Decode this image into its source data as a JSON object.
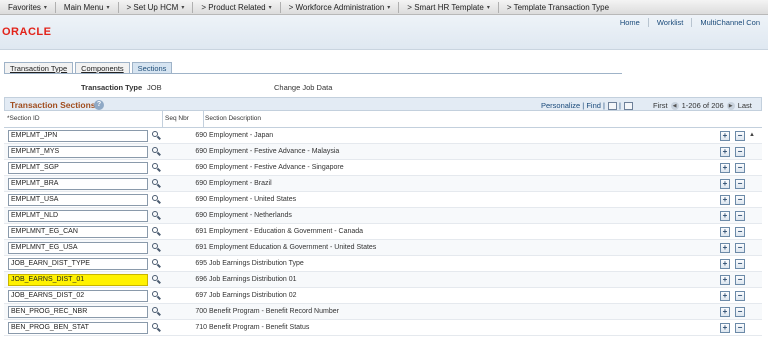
{
  "menubar": {
    "items": [
      {
        "label": "Favorites",
        "caret": "▾"
      },
      {
        "label": "Main Menu",
        "caret": "▾"
      },
      {
        "label": "> Set Up HCM",
        "caret": "▾"
      },
      {
        "label": "> Product Related",
        "caret": "▾"
      },
      {
        "label": "> Workforce Administration",
        "caret": "▾"
      },
      {
        "label": "> Smart HR Template",
        "caret": "▾"
      },
      {
        "label": "> Template Transaction Type",
        "caret": ""
      }
    ]
  },
  "header": {
    "logo": "ORACLE",
    "links": [
      "Home",
      "Worklist",
      "MultiChannel Con"
    ]
  },
  "tabs": [
    "Transaction Type",
    "Components",
    "Sections"
  ],
  "transaction_type": {
    "label": "Transaction Type",
    "value": "JOB",
    "description": "Change Job Data"
  },
  "grid": {
    "title": "Transaction Sections",
    "help": "?",
    "personalize": "Personalize",
    "find": "Find",
    "first": "First",
    "range": "1-206 of 206",
    "last": "Last",
    "columns": {
      "section_id": "*Section ID",
      "seq_nbr": "Seq Nbr",
      "section_desc": "Section Description"
    },
    "rows": [
      {
        "id": "EMPLMT_JPN",
        "seq": "690",
        "desc": "Employment - Japan"
      },
      {
        "id": "EMPLMT_MYS",
        "seq": "690",
        "desc": "Employment - Festive Advance - Malaysia"
      },
      {
        "id": "EMPLMT_SGP",
        "seq": "690",
        "desc": "Employment - Festive Advance - Singapore"
      },
      {
        "id": "EMPLMT_BRA",
        "seq": "690",
        "desc": "Employment - Brazil"
      },
      {
        "id": "EMPLMT_USA",
        "seq": "690",
        "desc": "Employment - United States"
      },
      {
        "id": "EMPLMT_NLD",
        "seq": "690",
        "desc": "Employment - Netherlands"
      },
      {
        "id": "EMPLMNT_EG_CAN",
        "seq": "691",
        "desc": "Employment - Education & Government - Canada"
      },
      {
        "id": "EMPLMNT_EG_USA",
        "seq": "691",
        "desc": "Employment Education & Government - United States"
      },
      {
        "id": "JOB_EARN_DIST_TYPE",
        "seq": "695",
        "desc": "Job Earnings Distribution Type"
      },
      {
        "id": "JOB_EARNS_DIST_01",
        "seq": "696",
        "desc": "Job Earnings Distribution 01",
        "highlighted": true
      },
      {
        "id": "JOB_EARNS_DIST_02",
        "seq": "697",
        "desc": "Job Earnings Distribution 02"
      },
      {
        "id": "BEN_PROG_REC_NBR",
        "seq": "700",
        "desc": "Benefit Program - Benefit Record Number"
      },
      {
        "id": "BEN_PROG_BEN_STAT",
        "seq": "710",
        "desc": "Benefit Program - Benefit Status"
      }
    ]
  },
  "colors": {
    "logo_red": "#e2231a",
    "grid_title": "#a04d1e",
    "highlight": "#fff200",
    "header_bg": "#dfe8f1"
  }
}
